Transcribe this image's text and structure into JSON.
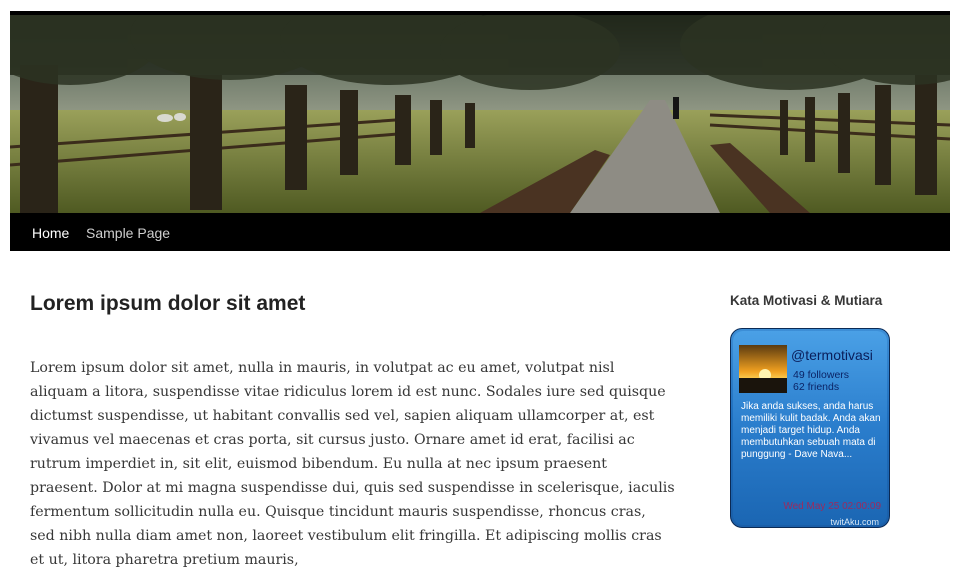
{
  "nav": {
    "items": [
      {
        "label": "Home",
        "active": true
      },
      {
        "label": "Sample Page",
        "active": false
      }
    ]
  },
  "post": {
    "title": "Lorem ipsum dolor sit amet",
    "body": "Lorem ipsum dolor sit amet, nulla in mauris, in volutpat ac eu amet, volutpat nisl aliquam a litora, suspendisse vitae ridiculus lorem id est nunc. Sodales iure sed quisque dictumst suspendisse, ut habitant convallis sed vel, sapien aliquam ullamcorper at, est vivamus vel maecenas et cras porta, sit cursus justo. Ornare amet id erat, facilisi ac rutrum imperdiet in, sit elit, euismod bibendum. Eu nulla at nec ipsum praesent praesent. Dolor at mi magna suspendisse dui, quis sed suspendisse in scelerisque, iaculis fermentum sollicitudin nulla eu. Quisque tincidunt mauris suspendisse, rhoncus cras, sed nibh nulla diam amet non, laoreet vestibulum elit fringilla. Et adipiscing mollis cras et ut, litora pharetra pretium mauris,"
  },
  "sidebar": {
    "widget_title": "Kata Motivasi & Mutiara",
    "twitter": {
      "handle": "@termotivasi",
      "followers": "49 followers",
      "friends": "62 friends",
      "tweet": "Jika anda sukses, anda harus memiliki kulit badak. Anda akan menjadi target hidup. Anda membutuhkan sebuah mata di punggung  - Dave Nava...",
      "date": "Wed May 25 02:00:09",
      "brand": "twitAku.com",
      "colors": {
        "box": "#1f6fbe",
        "handle": "#0a1e5a",
        "date": "#9b2b5e"
      }
    }
  },
  "icons": {
    "header": "tree-lined-path-photo",
    "avatar": "sunset-avatar"
  }
}
